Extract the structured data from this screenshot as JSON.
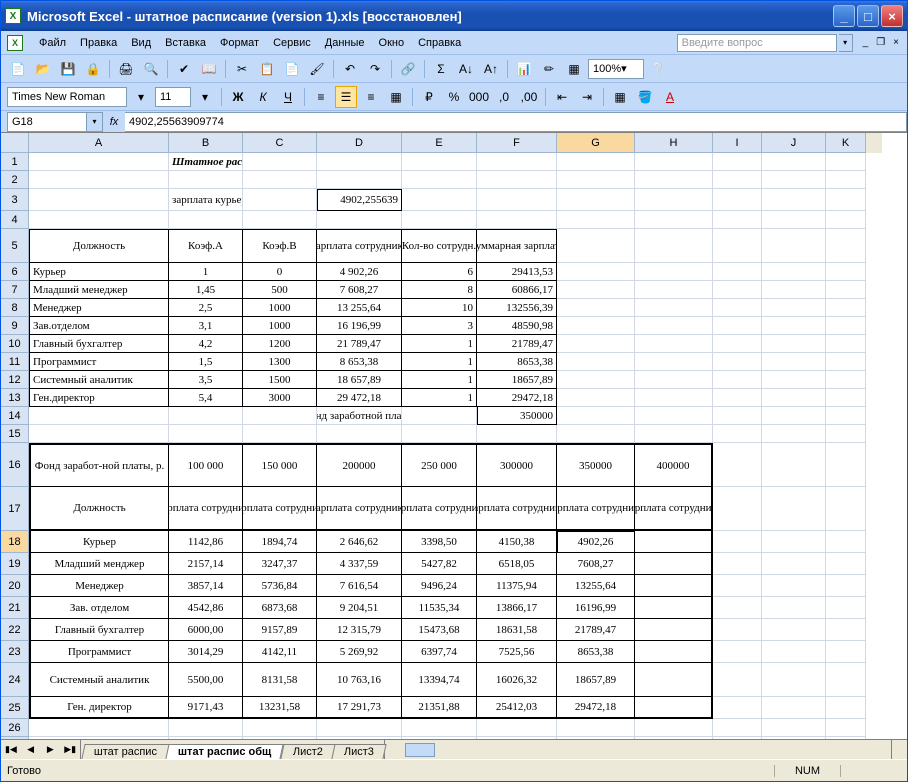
{
  "window": {
    "title": "Microsoft Excel - штатное расписание (version 1).xls [восстановлен]"
  },
  "menu": {
    "file": "Файл",
    "edit": "Правка",
    "view": "Вид",
    "insert": "Вставка",
    "format": "Формат",
    "tools": "Сервис",
    "data": "Данные",
    "window": "Окно",
    "help": "Справка",
    "ask_placeholder": "Введите вопрос"
  },
  "toolbar": {
    "zoom": "100%"
  },
  "format": {
    "font": "Times New Roman",
    "size": "11"
  },
  "formula": {
    "cell_ref": "G18",
    "fx": "fx",
    "value": "4902,25563909774"
  },
  "columns": [
    "A",
    "B",
    "C",
    "D",
    "E",
    "F",
    "G",
    "H",
    "I",
    "J",
    "K"
  ],
  "sheet": {
    "title": "Штатное расписание фирмы",
    "r3_label": "зарплата курьера",
    "r3_value": "4902,255639",
    "t1_headers": {
      "pos": "Должность",
      "ka": "Коэф.А",
      "kb": "Коэф.В",
      "sal": "Зарплата сотрудника",
      "cnt": "Кол-во сотрудн.",
      "sum": "Суммарная зарплата"
    },
    "t1_rows": [
      {
        "n": "6",
        "pos": "Курьер",
        "ka": "1",
        "kb": "0",
        "sal": "4 902,26",
        "cnt": "6",
        "sum": "29413,53"
      },
      {
        "n": "7",
        "pos": "Младший менеджер",
        "ka": "1,45",
        "kb": "500",
        "sal": "7 608,27",
        "cnt": "8",
        "sum": "60866,17"
      },
      {
        "n": "8",
        "pos": "Менеджер",
        "ka": "2,5",
        "kb": "1000",
        "sal": "13 255,64",
        "cnt": "10",
        "sum": "132556,39"
      },
      {
        "n": "9",
        "pos": "Зав.отделом",
        "ka": "3,1",
        "kb": "1000",
        "sal": "16 196,99",
        "cnt": "3",
        "sum": "48590,98"
      },
      {
        "n": "10",
        "pos": "Главный бухгалтер",
        "ka": "4,2",
        "kb": "1200",
        "sal": "21 789,47",
        "cnt": "1",
        "sum": "21789,47"
      },
      {
        "n": "11",
        "pos": "Программист",
        "ka": "1,5",
        "kb": "1300",
        "sal": "8 653,38",
        "cnt": "1",
        "sum": "8653,38"
      },
      {
        "n": "12",
        "pos": "Системный аналитик",
        "ka": "3,5",
        "kb": "1500",
        "sal": "18 657,89",
        "cnt": "1",
        "sum": "18657,89"
      },
      {
        "n": "13",
        "pos": "Ген.директор",
        "ka": "5,4",
        "kb": "3000",
        "sal": "29 472,18",
        "cnt": "1",
        "sum": "29472,18"
      }
    ],
    "fund_label": "Фонд заработной платы:",
    "fund_value": "350000",
    "t2_corner": "Фонд заработ-ной платы, р.",
    "t2_funds": [
      "100 000",
      "150 000",
      "200000",
      "250 000",
      "300000",
      "350000",
      "400000"
    ],
    "t2_pos_hdr": "Должность",
    "t2_sal_hdr": "Зарплата сотрудника",
    "t2_rows": [
      {
        "n": "18",
        "pos": "Курьер",
        "v": [
          "1142,86",
          "1894,74",
          "2 646,62",
          "3398,50",
          "4150,38",
          "4902,26",
          ""
        ]
      },
      {
        "n": "19",
        "pos": "Младший менджер",
        "v": [
          "2157,14",
          "3247,37",
          "4 337,59",
          "5427,82",
          "6518,05",
          "7608,27",
          ""
        ]
      },
      {
        "n": "20",
        "pos": "Менеджер",
        "v": [
          "3857,14",
          "5736,84",
          "7 616,54",
          "9496,24",
          "11375,94",
          "13255,64",
          ""
        ]
      },
      {
        "n": "21",
        "pos": "Зав. отделом",
        "v": [
          "4542,86",
          "6873,68",
          "9 204,51",
          "11535,34",
          "13866,17",
          "16196,99",
          ""
        ]
      },
      {
        "n": "22",
        "pos": "Главный бухгалтер",
        "v": [
          "6000,00",
          "9157,89",
          "12 315,79",
          "15473,68",
          "18631,58",
          "21789,47",
          ""
        ]
      },
      {
        "n": "23",
        "pos": "Программист",
        "v": [
          "3014,29",
          "4142,11",
          "5 269,92",
          "6397,74",
          "7525,56",
          "8653,38",
          ""
        ]
      },
      {
        "n": "24",
        "pos": "Системный аналитик",
        "v": [
          "5500,00",
          "8131,58",
          "10 763,16",
          "13394,74",
          "16026,32",
          "18657,89",
          ""
        ]
      },
      {
        "n": "25",
        "pos": "Ген. директор",
        "v": [
          "9171,43",
          "13231,58",
          "17 291,73",
          "21351,88",
          "25412,03",
          "29472,18",
          ""
        ]
      }
    ]
  },
  "tabs": {
    "t1": "штат распис",
    "t2": "штат распис общ",
    "t3": "Лист2",
    "t4": "Лист3"
  },
  "status": {
    "ready": "Готово",
    "num": "NUM"
  }
}
